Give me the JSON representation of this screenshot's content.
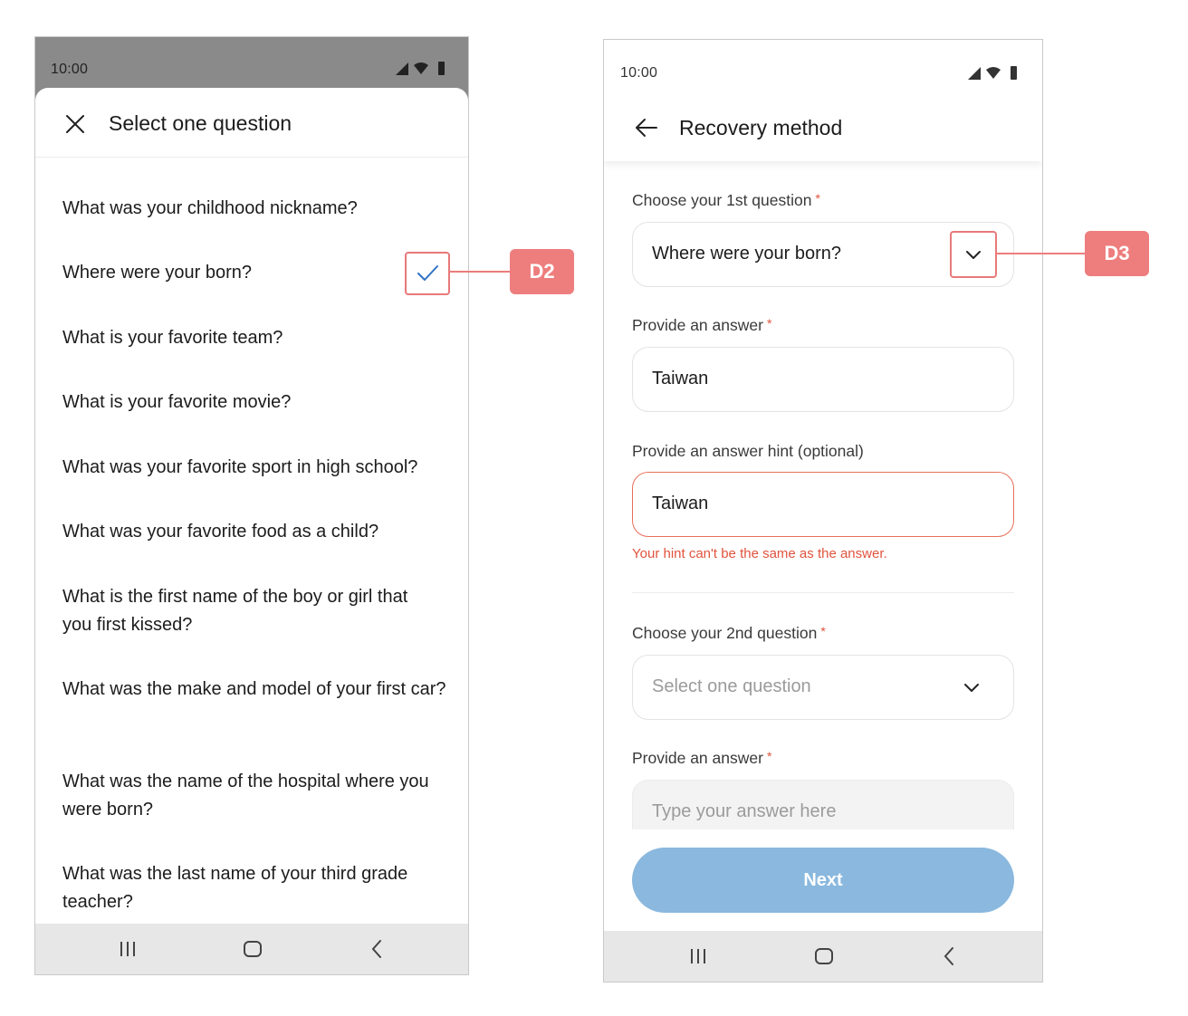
{
  "colors": {
    "accent_blue": "#2f72c4",
    "callout_red": "#ee7d7d",
    "error_red": "#e0533d",
    "next_button": "#8ab8de"
  },
  "left_screen": {
    "status_time": "10:00",
    "sheet_title": "Select one question",
    "questions": [
      "What was your childhood nickname?",
      "Where were your born?",
      "What is your favorite team?",
      "What is your favorite movie?",
      "What was your favorite sport in high school?",
      "What was your favorite food as a child?",
      "What is the first name of the boy or girl that you first kissed?",
      "What was the make and model of your first car?",
      "What was the name of the hospital where you were born?",
      "What was the last name of your third grade teacher?"
    ],
    "selected_question": "Where were your born?",
    "icons": [
      "close-icon",
      "check-icon",
      "nav-recents-icon",
      "nav-home-icon",
      "nav-back-icon"
    ]
  },
  "callouts": {
    "d2": "D2",
    "d3": "D3"
  },
  "right_screen": {
    "status_time": "10:00",
    "title": "Recovery method",
    "q1_label": "Choose your 1st question",
    "q1_value": "Where were your born?",
    "a1_label": "Provide an answer",
    "a1_value": "Taiwan",
    "hint_label": "Provide an answer hint (optional)",
    "hint_value": "Taiwan",
    "hint_error": "Your hint can't be the same as the answer.",
    "q2_label": "Choose your 2nd question",
    "q2_placeholder": "Select one question",
    "a2_label": "Provide an answer",
    "a2_placeholder": "Type your answer here",
    "required_mark": "*",
    "next_label": "Next"
  }
}
